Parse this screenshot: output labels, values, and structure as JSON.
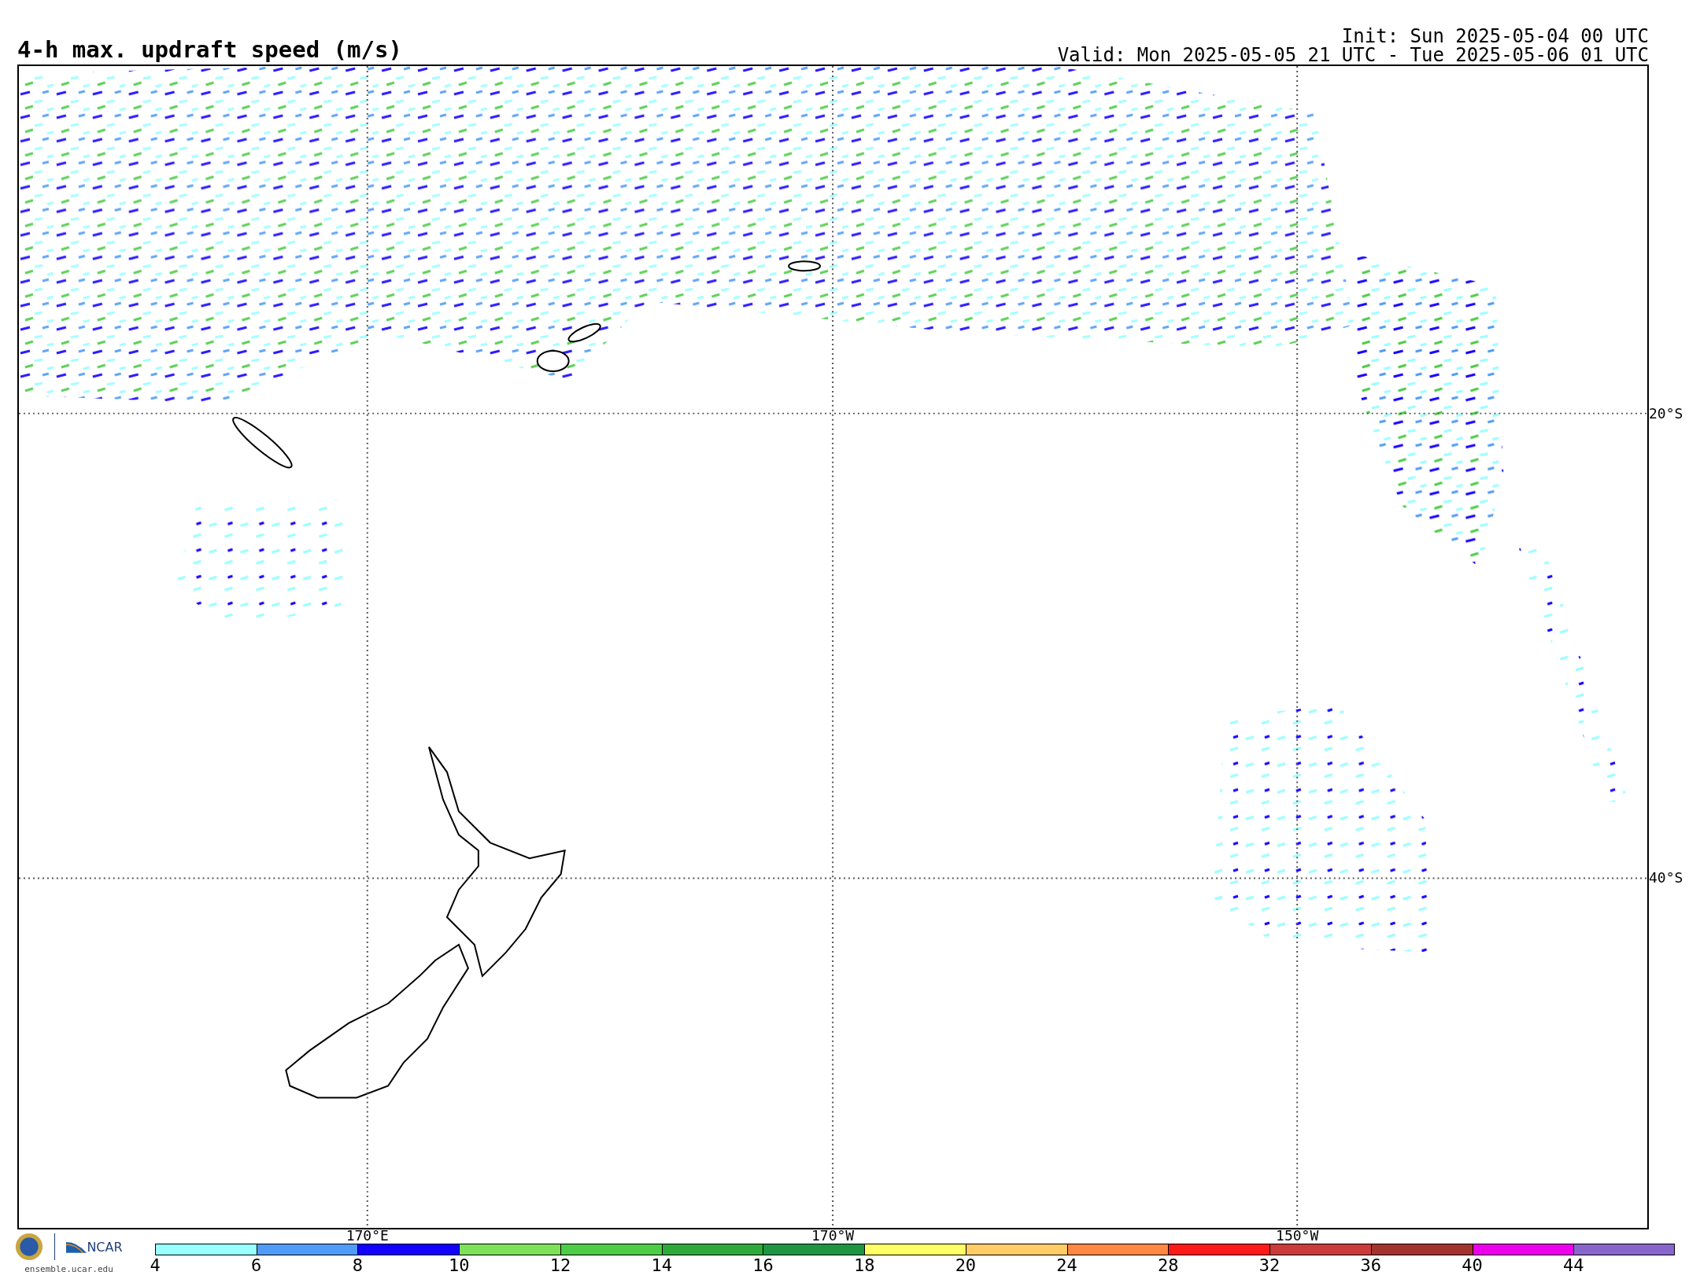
{
  "title": "4-h max. updraft speed (m/s)",
  "init": "Init: Sun 2025-05-04 00 UTC",
  "valid": "Valid: Mon 2025-05-05 21 UTC - Tue 2025-05-06 01 UTC",
  "map": {
    "lat_labels": [
      "20°S",
      "40°S"
    ],
    "lon_labels": [
      "170°E",
      "170°W",
      "150°W"
    ]
  },
  "logo": {
    "name": "NCAR",
    "url": "ensemble.ucar.edu"
  },
  "colorbar": [
    {
      "label": "4",
      "color": "#99ffff"
    },
    {
      "label": "6",
      "color": "#4f9bf7"
    },
    {
      "label": "8",
      "color": "#1400ff"
    },
    {
      "label": "10",
      "color": "#7fe05a"
    },
    {
      "label": "12",
      "color": "#4ccc47"
    },
    {
      "label": "14",
      "color": "#2eaa3a"
    },
    {
      "label": "16",
      "color": "#1f9443"
    },
    {
      "label": "18",
      "color": "#ffff66"
    },
    {
      "label": "20",
      "color": "#ffcc66"
    },
    {
      "label": "24",
      "color": "#ff8844"
    },
    {
      "label": "28",
      "color": "#ff1a1a"
    },
    {
      "label": "32",
      "color": "#cc3b3b"
    },
    {
      "label": "36",
      "color": "#a3332e"
    },
    {
      "label": "40",
      "color": "#ee00ee"
    },
    {
      "label": "44",
      "color": "#8866cc"
    }
  ]
}
